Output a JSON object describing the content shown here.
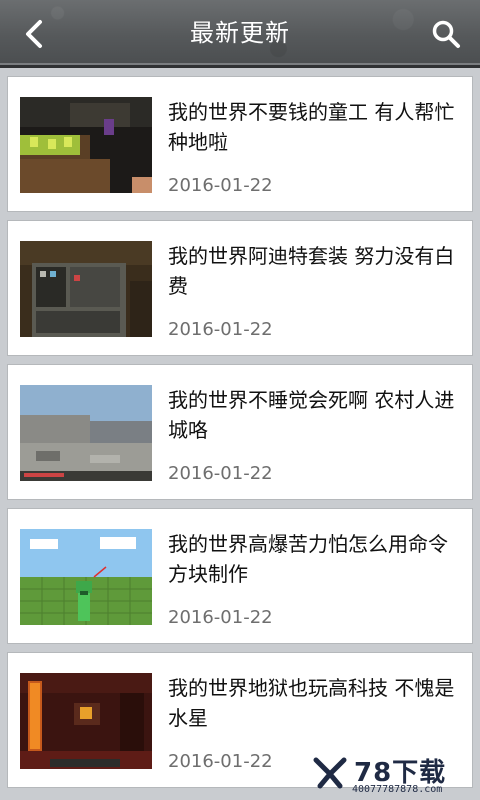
{
  "header": {
    "title": "最新更新",
    "back_icon": "chevron-left-icon",
    "search_icon": "search-icon"
  },
  "items": [
    {
      "title": "我的世界不要钱的童工 有人帮忙种地啦",
      "date": "2016-01-22"
    },
    {
      "title": "我的世界阿迪特套装 努力没有白费",
      "date": "2016-01-22"
    },
    {
      "title": "我的世界不睡觉会死啊 农村人进城咯",
      "date": "2016-01-22"
    },
    {
      "title": "我的世界高爆苦力怕怎么用命令方块制作",
      "date": "2016-01-22"
    },
    {
      "title": "我的世界地狱也玩高科技 不愧是水星",
      "date": "2016-01-22"
    }
  ],
  "watermark": {
    "brand": "78下载",
    "url": "40077787878.com"
  },
  "colors": {
    "header_bg": "#56595b",
    "page_bg": "#c9ccd0",
    "date_text": "#6e6e6e"
  }
}
